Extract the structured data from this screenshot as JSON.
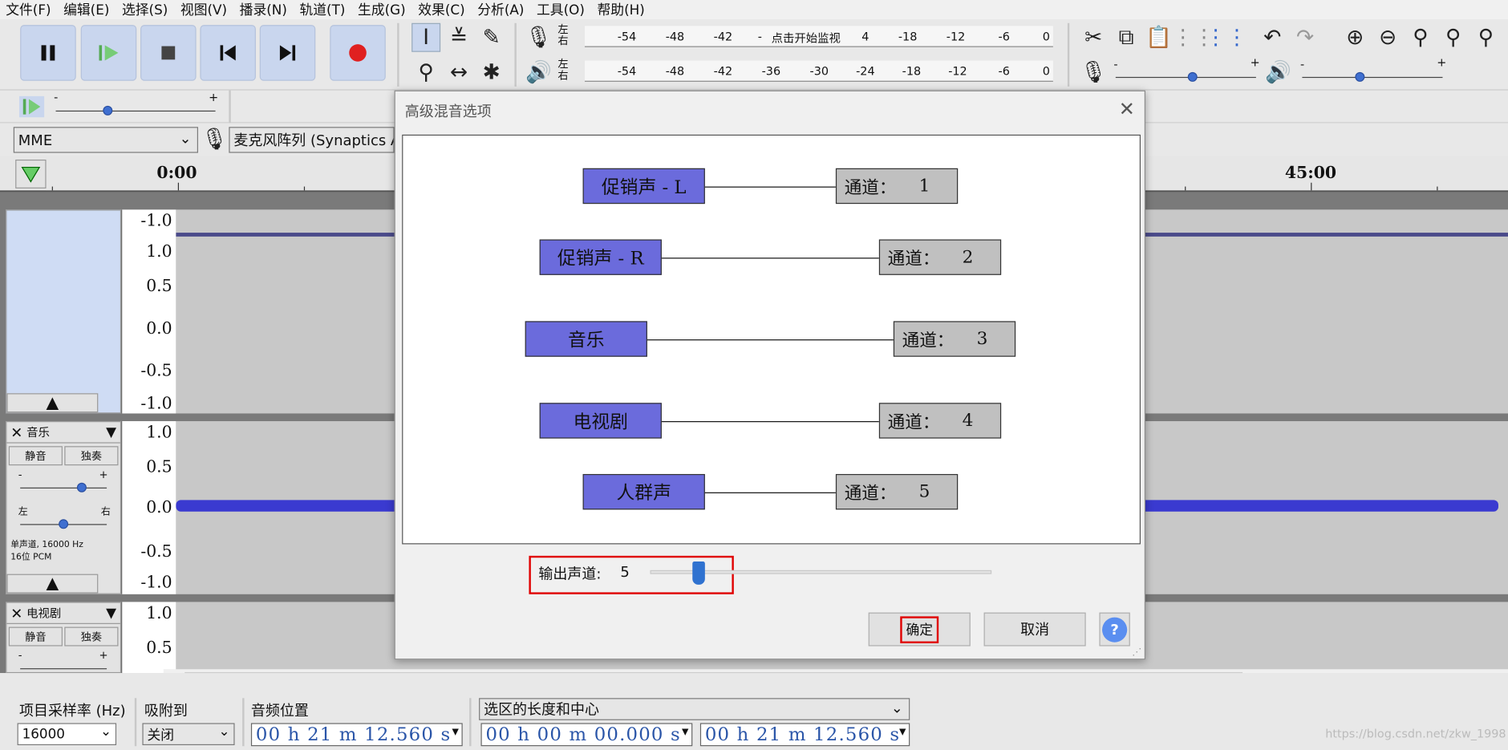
{
  "menu": [
    "文件(F)",
    "编辑(E)",
    "选择(S)",
    "视图(V)",
    "播录(N)",
    "轨道(T)",
    "生成(G)",
    "效果(C)",
    "分析(A)",
    "工具(O)",
    "帮助(H)"
  ],
  "meter": {
    "lr_left": "左",
    "lr_right": "右",
    "record_ticks": [
      "-54",
      "-48",
      "-42",
      "-",
      "点击开始监视",
      "4",
      "-18",
      "-12",
      "-6",
      "0"
    ],
    "play_ticks": [
      "-54",
      "-48",
      "-42",
      "-36",
      "-30",
      "-24",
      "-18",
      "-12",
      "-6",
      "0"
    ]
  },
  "slider": {
    "minus": "-",
    "plus": "+"
  },
  "device": {
    "host": "MME",
    "input": "麦克风阵列 (Synaptics A"
  },
  "ruler": {
    "start": "0:00",
    "end": "45:00"
  },
  "tracks": [
    {
      "scale": [
        "-1.0",
        "1.0",
        "0.5",
        "0.0",
        "-0.5",
        "-1.0"
      ]
    },
    {
      "name": "音乐",
      "mute": "静音",
      "solo": "独奏",
      "left": "左",
      "right": "右",
      "info": "单声道, 16000 Hz\n16位 PCM",
      "scale": [
        "1.0",
        "0.5",
        "0.0",
        "-0.5",
        "-1.0"
      ]
    },
    {
      "name": "电视剧",
      "mute": "静音",
      "solo": "独奏",
      "scale": [
        "1.0",
        "0.5"
      ]
    }
  ],
  "dialog": {
    "title": "高级混音选项",
    "sources": [
      "促销声 - L",
      "促销声 - R",
      "音乐",
      "电视剧",
      "人群声"
    ],
    "channel_label": "通道：",
    "channels": [
      "1",
      "2",
      "3",
      "4",
      "5"
    ],
    "output_label": "输出声道:",
    "output_value": "5",
    "output_level": 0.14,
    "ok": "确定",
    "cancel": "取消",
    "help": "?"
  },
  "bottom": {
    "rate_label": "项目采样率 (Hz)",
    "rate_value": "16000",
    "snap_label": "吸附到",
    "snap_value": "关闭",
    "pos_label": "音频位置",
    "pos_value": "00 h 21 m 12.560 s",
    "sel_label": "选区的长度和中心",
    "sel_len": "00 h 00 m 00.000 s",
    "sel_center": "00 h 21 m 12.560 s"
  },
  "watermark": "https://blog.csdn.net/zkw_1998",
  "colors": {
    "accent": "#3f6fd0",
    "source_box": "#6b6bdc",
    "highlight": "#e00000",
    "wave": "#3a3ad0"
  }
}
